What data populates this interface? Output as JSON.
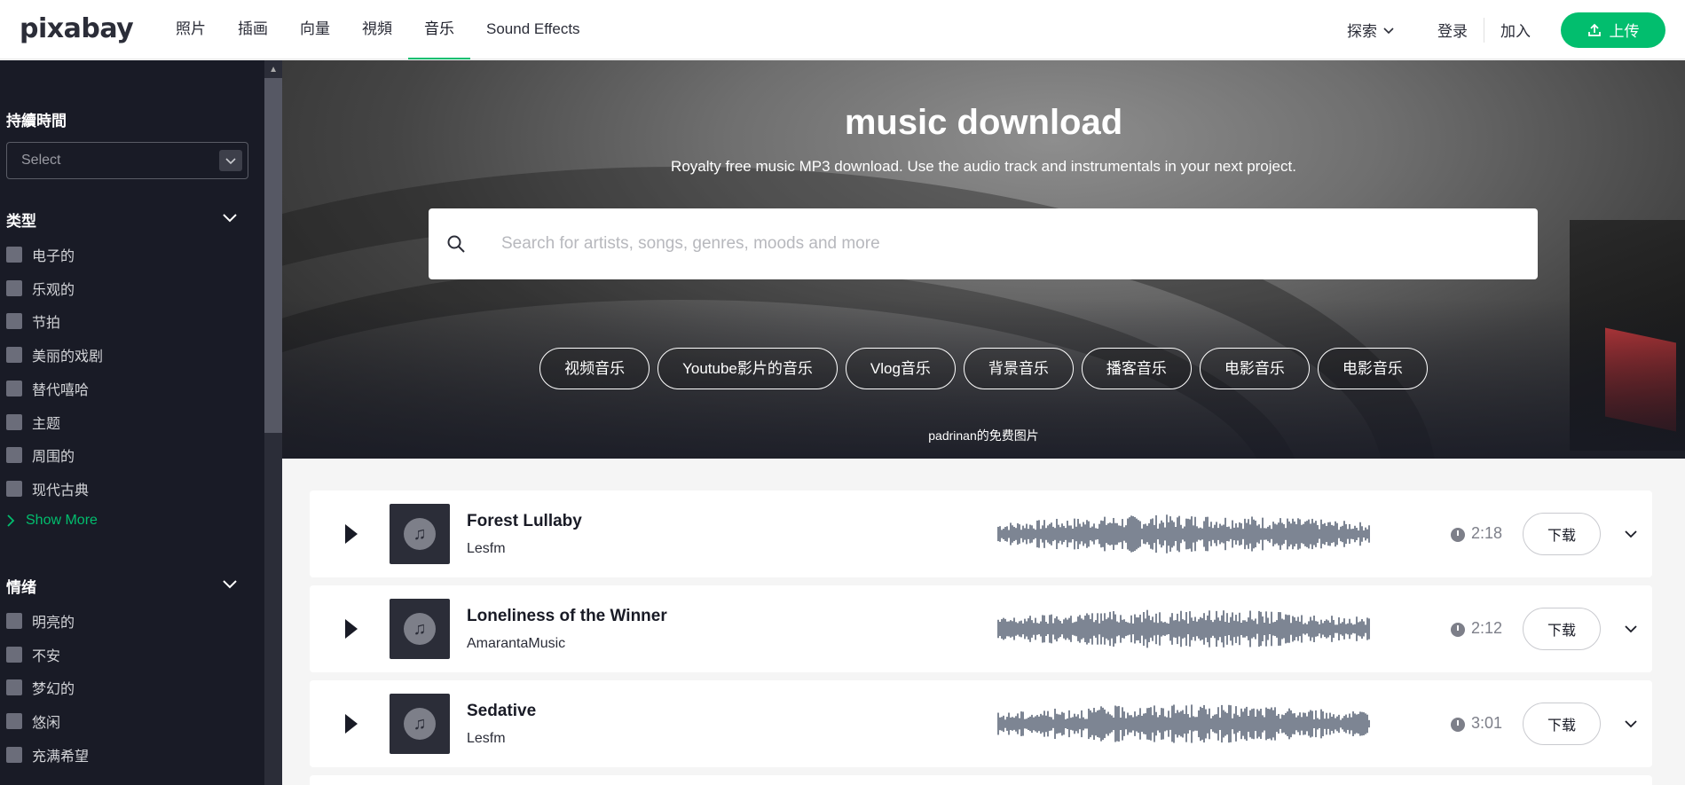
{
  "nav": {
    "logo": "pixabay",
    "links": [
      "照片",
      "插画",
      "向量",
      "視頻",
      "音乐",
      "Sound Effects"
    ],
    "active_index": 4,
    "explore": "探索",
    "login": "登录",
    "join": "加入",
    "upload": "上传",
    "accent": "#02be6e"
  },
  "sidebar": {
    "duration_title": "持續時間",
    "duration_select": "Select",
    "genre_title": "类型",
    "genres": [
      "电子的",
      "乐观的",
      "节拍",
      "美丽的戏剧",
      "替代嘻哈",
      "主题",
      "周围的",
      "现代古典"
    ],
    "show_more": "Show More",
    "mood_title": "情绪",
    "moods": [
      "明亮的",
      "不安",
      "梦幻的",
      "悠闲",
      "充满希望"
    ]
  },
  "hero": {
    "title": "music download",
    "subtitle": "Royalty free music MP3 download. Use the audio track and instrumentals in your next project.",
    "search_placeholder": "Search for artists, songs, genres, moods and more",
    "chips": [
      "视频音乐",
      "Youtube影片的音乐",
      "Vlog音乐",
      "背景音乐",
      "播客音乐",
      "电影音乐",
      "电影音乐"
    ],
    "credit": "padrinan的免费图片"
  },
  "tracks": [
    {
      "title": "Forest Lullaby",
      "artist": "Lesfm",
      "duration": "2:18",
      "download": "下载"
    },
    {
      "title": "Loneliness of the Winner",
      "artist": "AmarantaMusic",
      "duration": "2:12",
      "download": "下载"
    },
    {
      "title": "Sedative",
      "artist": "Lesfm",
      "duration": "3:01",
      "download": "下载"
    }
  ]
}
